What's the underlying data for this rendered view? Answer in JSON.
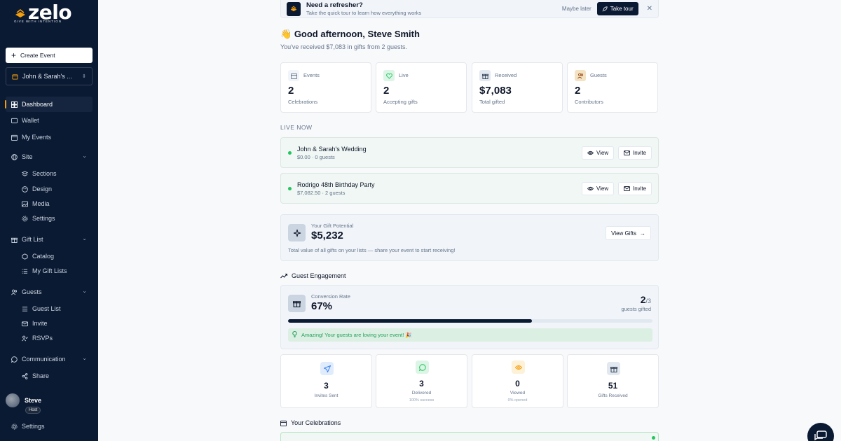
{
  "brand": {
    "name": "zelo",
    "tagline": "GIVE WITH INTENTION"
  },
  "sidebar": {
    "create_event": "Create Event",
    "event_selector": "John & Sarah's ...",
    "nav": {
      "dashboard": "Dashboard",
      "wallet": "Wallet",
      "my_events": "My Events",
      "site": "Site",
      "sections": "Sections",
      "design": "Design",
      "media": "Media",
      "settings_sub": "Settings",
      "gift_list": "Gift List",
      "catalog": "Catalog",
      "my_gift_lists": "My Gift Lists",
      "guests": "Guests",
      "guest_list": "Guest List",
      "invite": "Invite",
      "rsvps": "RSVPs",
      "communication": "Communication",
      "share": "Share",
      "settings": "Settings"
    },
    "user": {
      "name": "Steve",
      "role": "Host"
    }
  },
  "banner": {
    "title": "Need a refresher?",
    "subtitle": "Take the quick tour to learn how everything works",
    "maybe_later": "Maybe later",
    "take_tour": "Take tour"
  },
  "greeting": {
    "emoji": "👋",
    "title": "Good afternoon, Steve Smith",
    "subtitle": "You've received $7,083 in gifts from 2 guests."
  },
  "stats": [
    {
      "label": "Events",
      "value": "2",
      "sub": "Celebrations"
    },
    {
      "label": "Live",
      "value": "2",
      "sub": "Accepting gifts"
    },
    {
      "label": "Received",
      "value": "$7,083",
      "sub": "Total gifted"
    },
    {
      "label": "Guests",
      "value": "2",
      "sub": "Contributors"
    }
  ],
  "live_now": {
    "heading": "LIVE NOW",
    "view_label": "View",
    "invite_label": "Invite",
    "events": [
      {
        "name": "John & Sarah's Wedding",
        "meta": "$0.00 · 0 guests"
      },
      {
        "name": "Rodrigo 48th Birthday Party",
        "meta": "$7,082.50 · 2 guests"
      }
    ]
  },
  "gift_potential": {
    "label": "Your Gift Potential",
    "value": "$5,232",
    "subtitle": "Total value of all gifts on your lists — share your event to start receiving!",
    "button": "View Gifts"
  },
  "engagement": {
    "heading": "Guest Engagement",
    "label": "Conversion Rate",
    "value": "67%",
    "gifted": "2",
    "total": "/3",
    "gifted_label": "guests gifted",
    "progress": 0.67,
    "note": "Amazing! Your guests are loving your event! 🎉"
  },
  "metrics": [
    {
      "value": "3",
      "label": "Invites Sent",
      "sub": ""
    },
    {
      "value": "3",
      "label": "Delivered",
      "sub": "100% success"
    },
    {
      "value": "0",
      "label": "Viewed",
      "sub": "0% opened"
    },
    {
      "value": "51",
      "label": "Gifts Received",
      "sub": ""
    }
  ],
  "celebrations": {
    "heading": "Your Celebrations"
  },
  "colors": {
    "sidebar": "#0b1a33",
    "accent": "#f59e0b",
    "live": "#22c55e"
  }
}
